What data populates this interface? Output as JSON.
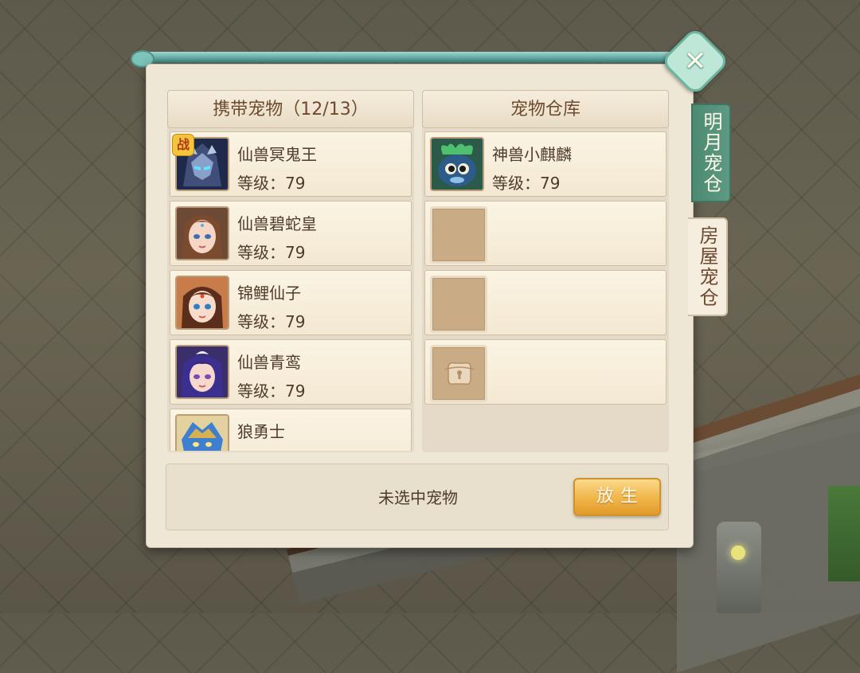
{
  "dialog": {
    "close_icon": "close-icon"
  },
  "carry": {
    "title": "携带宠物（12/13）",
    "pets": [
      {
        "name": "仙兽冥鬼王",
        "level": "等级：79",
        "in_battle": true,
        "badge": "战",
        "portrait": "dark-armored-demon-king"
      },
      {
        "name": "仙兽碧蛇皇",
        "level": "等级：79",
        "in_battle": false,
        "portrait": "brown-haired-maiden"
      },
      {
        "name": "锦鲤仙子",
        "level": "等级：79",
        "in_battle": false,
        "portrait": "koi-fairy-girl"
      },
      {
        "name": "仙兽青鸾",
        "level": "等级：79",
        "in_battle": false,
        "portrait": "purple-haired-maiden"
      },
      {
        "name": "狼勇士",
        "level": "",
        "in_battle": false,
        "portrait": "blue-wolf-warrior"
      }
    ]
  },
  "warehouse": {
    "title": "宠物仓库",
    "slots": [
      {
        "type": "pet",
        "name": "神兽小麒麟",
        "level": "等级：79",
        "portrait": "baby-qilin"
      },
      {
        "type": "empty"
      },
      {
        "type": "empty"
      },
      {
        "type": "locked",
        "icon": "lock-icon"
      }
    ]
  },
  "footer": {
    "status": "未选中宠物",
    "release_label": "放生"
  },
  "tabs": {
    "moon_label": "明月宠仓",
    "house_label": "房屋宠仓",
    "active": "house"
  },
  "colors": {
    "panel_bg": "#efe7d6",
    "button_orange": "#f0b548",
    "tab_green": "#4d8a72",
    "text_brown": "#4f3b2a"
  }
}
